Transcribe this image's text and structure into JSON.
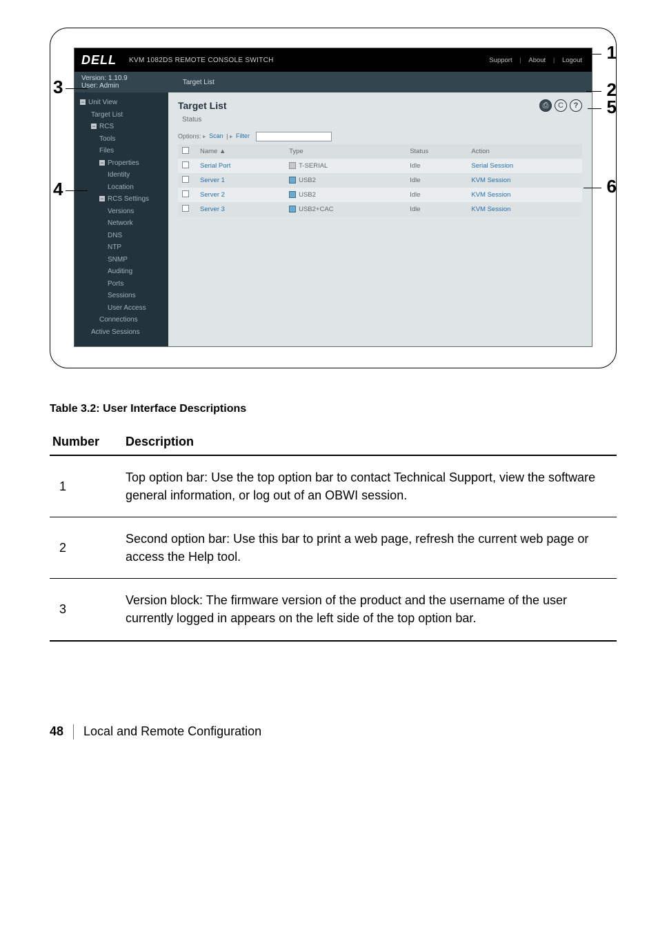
{
  "app": {
    "logo": "DELL",
    "header_title": "KVM 1082DS REMOTE CONSOLE SWITCH",
    "top_links": {
      "support": "Support",
      "about": "About",
      "logout": "Logout"
    }
  },
  "version_block": {
    "version_label": "Version:",
    "version_value": "1.10.9",
    "user": "User: Admin",
    "breadcrumb": "Target List"
  },
  "sidebar": {
    "items": [
      {
        "label": "Unit View",
        "lvl": "lvl1",
        "deco": "minus"
      },
      {
        "label": "Target List",
        "lvl": "lvl2",
        "deco": ""
      },
      {
        "label": "RCS",
        "lvl": "lvl2",
        "deco": "minus"
      },
      {
        "label": "Tools",
        "lvl": "lvl3",
        "deco": ""
      },
      {
        "label": "Files",
        "lvl": "lvl3",
        "deco": ""
      },
      {
        "label": "Properties",
        "lvl": "lvl3",
        "deco": "minus"
      },
      {
        "label": "Identity",
        "lvl": "lvl4",
        "deco": ""
      },
      {
        "label": "Location",
        "lvl": "lvl4",
        "deco": ""
      },
      {
        "label": "RCS Settings",
        "lvl": "lvl3",
        "deco": "minus"
      },
      {
        "label": "Versions",
        "lvl": "lvl4",
        "deco": ""
      },
      {
        "label": "Network",
        "lvl": "lvl4",
        "deco": ""
      },
      {
        "label": "DNS",
        "lvl": "lvl4",
        "deco": ""
      },
      {
        "label": "NTP",
        "lvl": "lvl4",
        "deco": ""
      },
      {
        "label": "SNMP",
        "lvl": "lvl4",
        "deco": ""
      },
      {
        "label": "Auditing",
        "lvl": "lvl4",
        "deco": ""
      },
      {
        "label": "Ports",
        "lvl": "lvl4",
        "deco": ""
      },
      {
        "label": "Sessions",
        "lvl": "lvl4",
        "deco": ""
      },
      {
        "label": "User Access",
        "lvl": "lvl4",
        "deco": ""
      },
      {
        "label": "Connections",
        "lvl": "lvl3",
        "deco": ""
      },
      {
        "label": "Active Sessions",
        "lvl": "lvl2",
        "deco": ""
      }
    ]
  },
  "content": {
    "heading": "Target List",
    "status_label": "Status",
    "options": {
      "label": "Options:",
      "scan": "Scan",
      "filter": "Filter",
      "filter_value": ""
    },
    "toolbar_icons": {
      "print": "⎙",
      "refresh": "C",
      "help": "?"
    },
    "columns": {
      "chk": "",
      "name": "Name ▲",
      "type": "Type",
      "status": "Status",
      "action": "Action"
    },
    "rows": [
      {
        "name": "Serial Port",
        "type": "T-SERIAL",
        "icon": "serial",
        "status": "Idle",
        "action": "Serial Session"
      },
      {
        "name": "Server 1",
        "type": "USB2",
        "icon": "kvm",
        "status": "Idle",
        "action": "KVM Session"
      },
      {
        "name": "Server 2",
        "type": "USB2",
        "icon": "kvm",
        "status": "Idle",
        "action": "KVM Session"
      },
      {
        "name": "Server 3",
        "type": "USB2+CAC",
        "icon": "kvm",
        "status": "Idle",
        "action": "KVM Session"
      }
    ]
  },
  "callouts": {
    "c1": "1",
    "c2": "2",
    "c3": "3",
    "c4": "4",
    "c5": "5",
    "c6": "6"
  },
  "table_caption": "Table 3.2: User Interface Descriptions",
  "desc_headers": {
    "num": "Number",
    "desc": "Description"
  },
  "desc_rows": [
    {
      "num": "1",
      "text": "Top option bar: Use the top option bar to contact Technical Support, view the software general information, or log out of an OBWI session."
    },
    {
      "num": "2",
      "text": "Second option bar: Use this bar to print a web page, refresh the current web page or access the Help tool."
    },
    {
      "num": "3",
      "text": "Version block: The firmware version of the product and the username of the user currently logged in appears on the left side of the top option bar."
    }
  ],
  "footer": {
    "page": "48",
    "section": "Local and Remote Configuration"
  }
}
